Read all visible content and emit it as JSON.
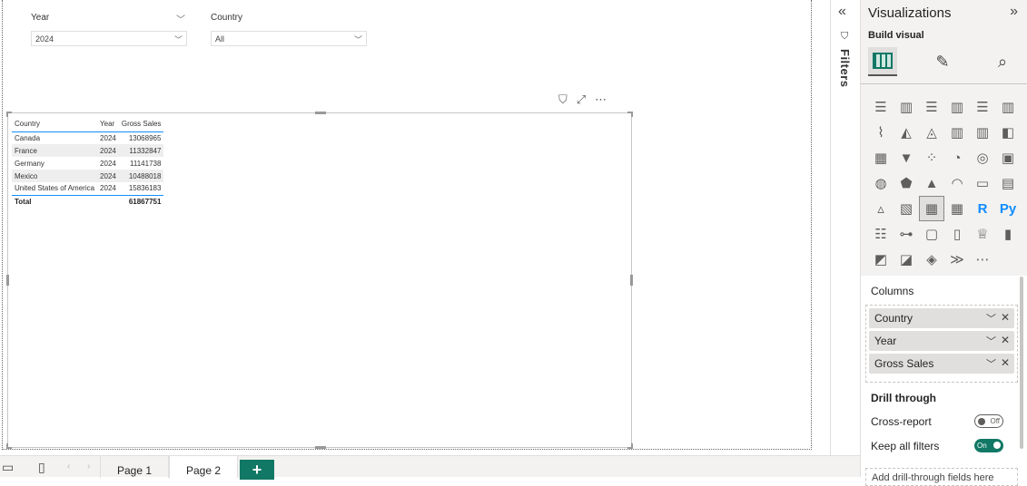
{
  "slicers": {
    "year": {
      "label": "Year",
      "value": "2024"
    },
    "country": {
      "label": "Country",
      "value": "All"
    }
  },
  "table": {
    "headers": [
      "Country",
      "Year",
      "Gross Sales"
    ],
    "rows": [
      [
        "Canada",
        "2024",
        "13068965"
      ],
      [
        "France",
        "2024",
        "11332847"
      ],
      [
        "Germany",
        "2024",
        "11141738"
      ],
      [
        "Mexico",
        "2024",
        "10488018"
      ],
      [
        "United States of America",
        "2024",
        "15836183"
      ]
    ],
    "total": {
      "label": "Total",
      "value": "61867751"
    }
  },
  "filters": {
    "label": "Filters"
  },
  "viz": {
    "title": "Visualizations",
    "build_label": "Build visual",
    "icons": [
      "stacked-bar-icon",
      "stacked-column-icon",
      "clustered-bar-icon",
      "clustered-column-icon",
      "100-bar-icon",
      "100-column-icon",
      "line-chart-icon",
      "area-chart-icon",
      "stacked-area-icon",
      "line-column-icon",
      "line-clustered-icon",
      "ribbon-chart-icon",
      "waterfall-icon",
      "funnel-icon",
      "scatter-icon",
      "pie-icon",
      "donut-icon",
      "treemap-icon",
      "map-icon",
      "filled-map-icon",
      "azure-map-icon",
      "gauge-icon",
      "card-icon",
      "multirow-card-icon",
      "kpi-icon",
      "slicer-icon",
      "table-icon",
      "matrix-icon",
      "r-visual-icon",
      "python-visual-icon",
      "key-influencers-icon",
      "decomposition-tree-icon",
      "qa-icon",
      "smart-narrative-icon",
      "metrics-icon",
      "paginated-report-icon",
      "power-apps-icon",
      "power-automate-icon",
      "power-bi-icon",
      "arcgis-icon",
      "more-icon"
    ],
    "columns_label": "Columns",
    "fields": [
      "Country",
      "Year",
      "Gross Sales"
    ],
    "drill_through_label": "Drill through",
    "cross_report_label": "Cross-report",
    "cross_report_state": "Off",
    "keep_filters_label": "Keep all filters",
    "keep_filters_state": "On",
    "add_drill_placeholder": "Add drill-through fields here"
  },
  "pages": {
    "tabs": [
      "Page 1",
      "Page 2"
    ],
    "active": "Page 2",
    "add_label": "+"
  },
  "colors": {
    "accent": "#117865",
    "table_line": "#118dff"
  }
}
